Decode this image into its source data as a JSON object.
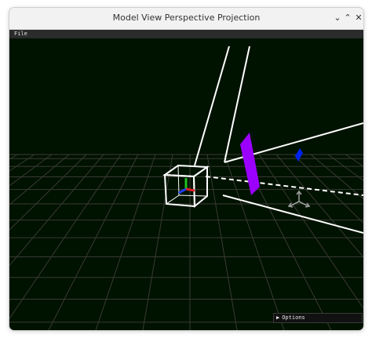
{
  "window": {
    "title": "Model View Perspective Projection",
    "controls": {
      "minimize": "⌄",
      "maximize": "⌃",
      "close": "✕"
    }
  },
  "menubar": {
    "file_label": "File"
  },
  "options_panel": {
    "collapsed_icon": "▶",
    "label": "Options"
  },
  "scene": {
    "background": "#001200",
    "grid_color": "#3a3a34",
    "frustum_color": "#ffffff",
    "near_plane_color": "#9b00ff",
    "target_marker_color": "#0022ee",
    "axis_colors": {
      "x": "#e02020",
      "y": "#20c020",
      "z": "#2040ff"
    },
    "gizmo_color": "#9a9a9a"
  }
}
